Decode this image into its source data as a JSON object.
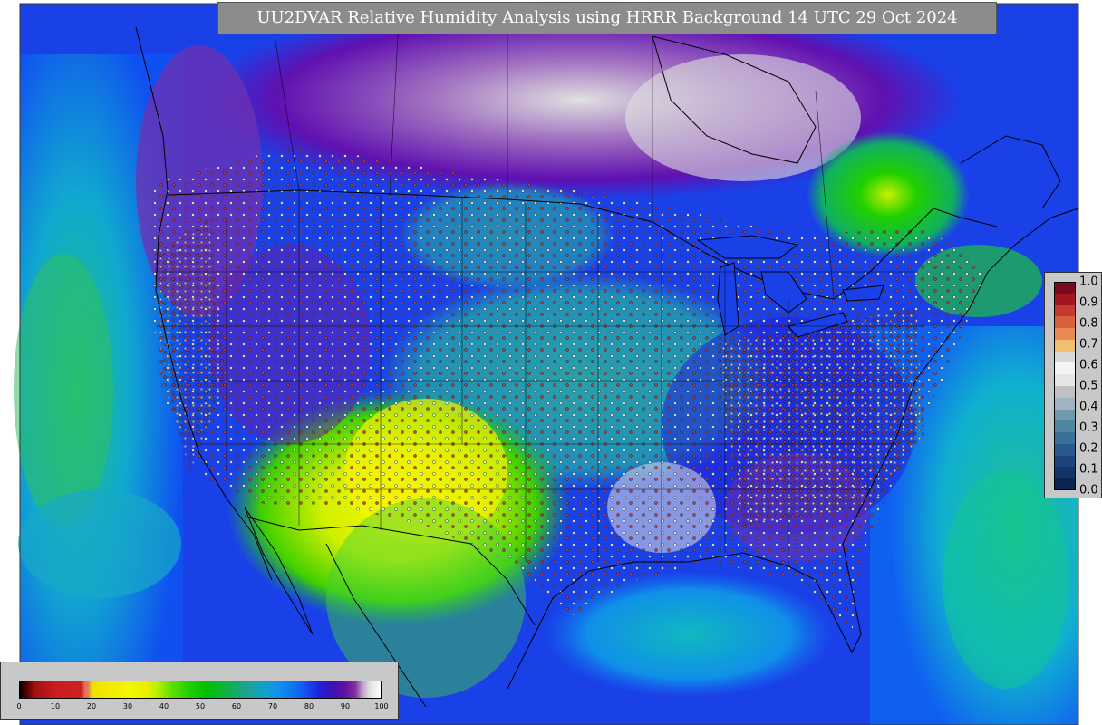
{
  "title": "UU2DVAR Relative Humidity Analysis using HRRR Background 14 UTC 29 Oct 2024",
  "rh_colorbar": {
    "ticks": [
      "0",
      "10",
      "20",
      "30",
      "40",
      "50",
      "60",
      "70",
      "80",
      "90",
      "100"
    ],
    "range": [
      0,
      100
    ]
  },
  "ob_colorbar": {
    "labels": [
      "1.0",
      "0.9",
      "0.8",
      "0.7",
      "0.6",
      "0.5",
      "0.4",
      "0.3",
      "0.2",
      "0.1",
      "0.0"
    ],
    "colors": [
      "#7a0a1e",
      "#a4161f",
      "#c43a32",
      "#d8603a",
      "#e88a55",
      "#f0c070",
      "#d8d8d8",
      "#f4f4f4",
      "#e6e6e6",
      "#c0c0c0",
      "#a0b4c0",
      "#6f9aae",
      "#4f86a0",
      "#3a6f98",
      "#2a5a8c",
      "#1c4478",
      "#123466",
      "#0a2454"
    ]
  },
  "colors": {
    "title_bg": "#8c8c8c",
    "legend_bg": "#c8c8c8",
    "ocean_green": "#20b8a0",
    "land_blue": "#1a50f0",
    "dry_yellow": "#f0f000",
    "saturated_white": "#e0e0e0"
  }
}
